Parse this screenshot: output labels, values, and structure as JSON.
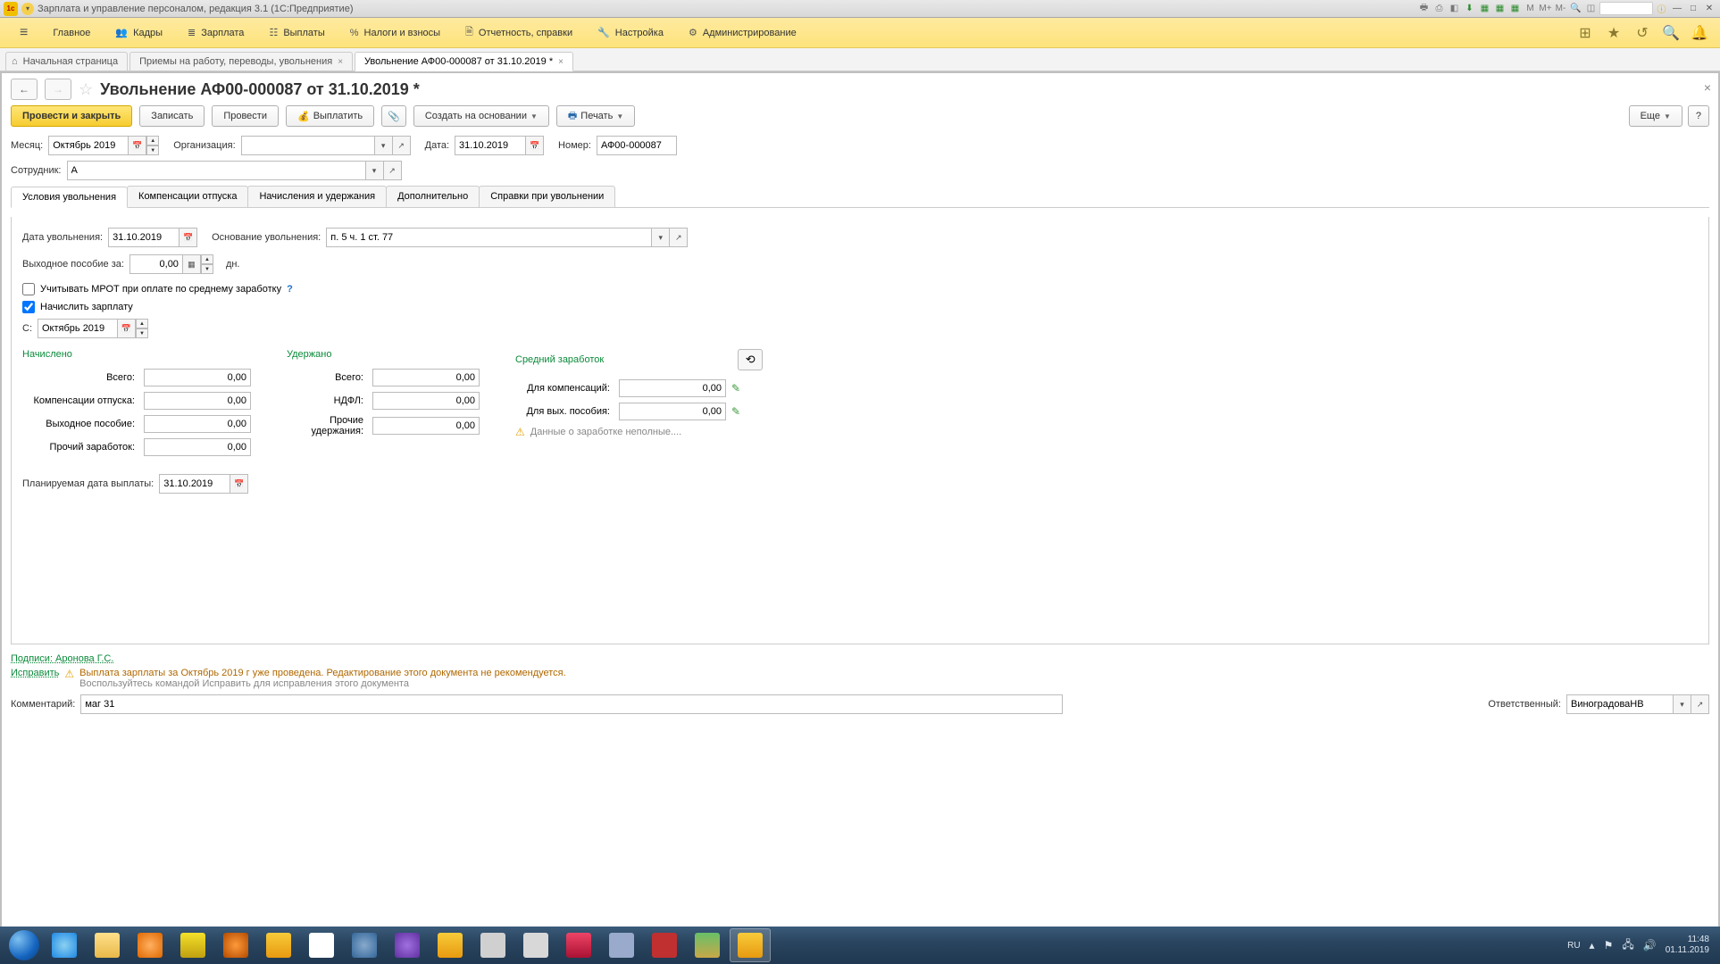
{
  "title_bar": {
    "app_title": "Зарплата и управление персоналом, редакция 3.1  (1С:Предприятие)",
    "m_labels": [
      "M",
      "M+",
      "M-"
    ]
  },
  "main_menu": [
    {
      "label": "Главное"
    },
    {
      "label": "Кадры"
    },
    {
      "label": "Зарплата"
    },
    {
      "label": "Выплаты"
    },
    {
      "label": "Налоги и взносы"
    },
    {
      "label": "Отчетность, справки"
    },
    {
      "label": "Настройка"
    },
    {
      "label": "Администрирование"
    }
  ],
  "page_tabs": {
    "home": "Начальная страница",
    "t1": "Приемы на работу, переводы, увольнения",
    "t2": "Увольнение АФ00-000087 от 31.10.2019 *"
  },
  "page_title": "Увольнение АФ00-000087 от 31.10.2019 *",
  "toolbar": {
    "post_close": "Провести и закрыть",
    "save": "Записать",
    "post": "Провести",
    "pay": "Выплатить",
    "create": "Создать на основании",
    "print": "Печать",
    "more": "Еще",
    "help": "?"
  },
  "header": {
    "month_lbl": "Месяц:",
    "month_val": "Октябрь 2019",
    "org_lbl": "Организация:",
    "org_val": "",
    "date_lbl": "Дата:",
    "date_val": "31.10.2019",
    "num_lbl": "Номер:",
    "num_val": "АФ00-000087",
    "emp_lbl": "Сотрудник:",
    "emp_val": "А"
  },
  "tabs": [
    "Условия увольнения",
    "Компенсации отпуска",
    "Начисления и удержания",
    "Дополнительно",
    "Справки при увольнении"
  ],
  "cond": {
    "term_date_lbl": "Дата увольнения:",
    "term_date_val": "31.10.2019",
    "reason_lbl": "Основание увольнения:",
    "reason_val": "п. 5 ч. 1 ст. 77",
    "sev_lbl": "Выходное пособие за:",
    "sev_val": "0,00",
    "sev_unit": "дн.",
    "mrot_chk": "Учитывать МРОТ при оплате по среднему заработку",
    "accrue_chk": "Начислить зарплату",
    "from_lbl": "С:",
    "from_val": "Октябрь 2019"
  },
  "calc": {
    "accrued_head": "Начислено",
    "withheld_head": "Удержано",
    "avg_head": "Средний заработок",
    "total_lbl": "Всего:",
    "total_accr": "0,00",
    "comp_vac_lbl": "Компенсации отпуска:",
    "comp_vac": "0,00",
    "sev_lbl": "Выходное пособие:",
    "sev": "0,00",
    "other_lbl": "Прочий заработок:",
    "other": "0,00",
    "total_with": "0,00",
    "ndfl_lbl": "НДФЛ:",
    "ndfl": "0,00",
    "other_with_lbl": "Прочие удержания:",
    "other_with": "0,00",
    "for_comp_lbl": "Для компенсаций:",
    "for_comp": "0,00",
    "for_sev_lbl": "Для вых. пособия:",
    "for_sev": "0,00",
    "warn": "Данные о заработке неполные...."
  },
  "plan_date_lbl": "Планируемая дата выплаты:",
  "plan_date_val": "31.10.2019",
  "signatures": "Подписи: Аронова Г.С.",
  "fix_link": "Исправить",
  "warning_msg": "Выплата зарплаты за Октябрь 2019 г уже проведена. Редактирование этого документа не рекомендуется.",
  "warning_msg2": "Воспользуйтесь командой Исправить для исправления этого документа",
  "comment_lbl": "Комментарий:",
  "comment_val": "маг 31",
  "resp_lbl": "Ответственный:",
  "resp_val": "ВиноградоваНВ",
  "tray": {
    "lang": "RU",
    "time": "11:48",
    "date": "01.11.2019"
  }
}
